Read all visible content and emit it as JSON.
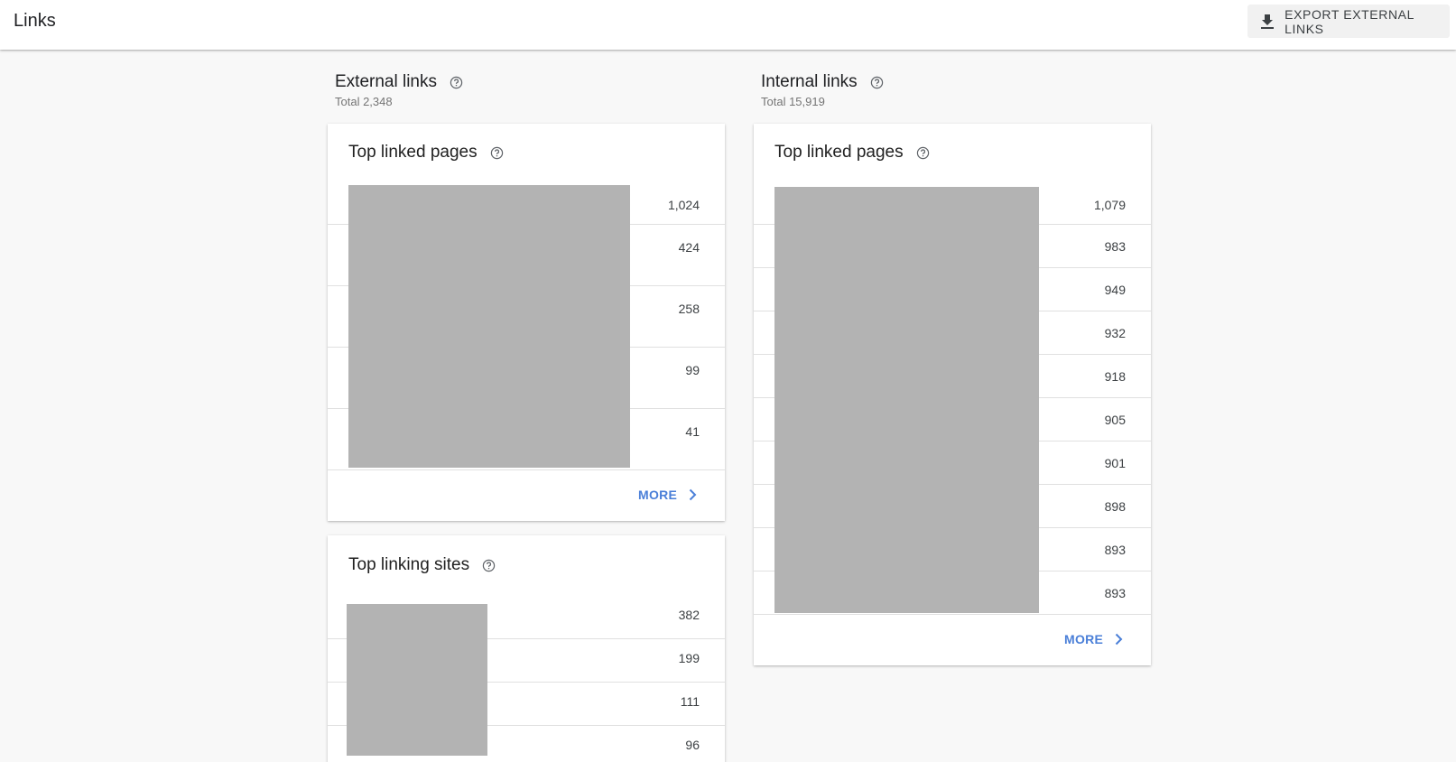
{
  "header": {
    "title": "Links",
    "export_label": "EXPORT EXTERNAL LINKS"
  },
  "external": {
    "title": "External links",
    "total": "Total 2,348",
    "top_linked_pages": {
      "title": "Top linked pages",
      "values": [
        "1,024",
        "424",
        "258",
        "99",
        "41"
      ],
      "more_label": "MORE"
    },
    "top_linking_sites": {
      "title": "Top linking sites",
      "values": [
        "382",
        "199",
        "111",
        "96"
      ]
    }
  },
  "internal": {
    "title": "Internal links",
    "total": "Total 15,919",
    "top_linked_pages": {
      "title": "Top linked pages",
      "values": [
        "1,079",
        "983",
        "949",
        "932",
        "918",
        "905",
        "901",
        "898",
        "893",
        "893"
      ],
      "more_label": "MORE"
    }
  },
  "colors": {
    "accent": "#4a7fd8",
    "bar": "#b3b3b3"
  },
  "icons": {
    "export": "download-icon",
    "help": "help-circle-icon",
    "more": "chevron-right-icon"
  }
}
